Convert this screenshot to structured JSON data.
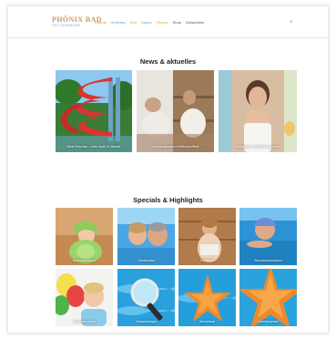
{
  "colors": {
    "brand_gold": "#c99a5c",
    "brand_blue": "#6aaad0",
    "nav_active": "#d9883a"
  },
  "header": {
    "logo_main": "PHÖNIX BAD",
    "logo_sub": "SPITZENBÄDER",
    "nav": [
      {
        "label": "Therme",
        "color": "#d9883a"
      },
      {
        "label": "Wellness",
        "color": "#6aaad0"
      },
      {
        "label": "Bad",
        "color": "#e4a63c"
      },
      {
        "label": "Sauna",
        "color": "#58b0d8"
      },
      {
        "label": "Fitness",
        "color": "#e3a24a"
      },
      {
        "label": "Shop",
        "color": "#555555"
      },
      {
        "label": "Gutscheine",
        "color": "#555555"
      }
    ],
    "menu_icon": "chevron-down-icon",
    "menu_glyph": "∨"
  },
  "news": {
    "title": "News & aktuelles",
    "items": [
      {
        "caption": "Neue Rutschen – mehr Spaß im Wasser",
        "image": "water-slides"
      },
      {
        "caption": "Saunaaufgüsse mit Wellness-Effekt",
        "image": "sauna-relax"
      },
      {
        "caption": "Massagen & Wohlfühl-Angebote",
        "image": "spa-woman"
      }
    ]
  },
  "specials": {
    "title": "Specials & Highlights",
    "items": [
      {
        "caption": "Babyschwimmen",
        "image": "baby-in-towel"
      },
      {
        "caption": "Familienbad",
        "image": "couple-in-pool"
      },
      {
        "caption": "Saunawelt",
        "image": "woman-in-sauna"
      },
      {
        "caption": "Seniorenschwimmen",
        "image": "senior-swimming"
      },
      {
        "caption": "Kindergeburtstag",
        "image": "child-with-balloons"
      },
      {
        "caption": "Wasseranalyse",
        "image": "magnifier-water"
      },
      {
        "caption": "Sternenbad",
        "image": "starfish-pool"
      },
      {
        "caption": "Sommerspecial",
        "image": "starfish-close"
      }
    ]
  }
}
